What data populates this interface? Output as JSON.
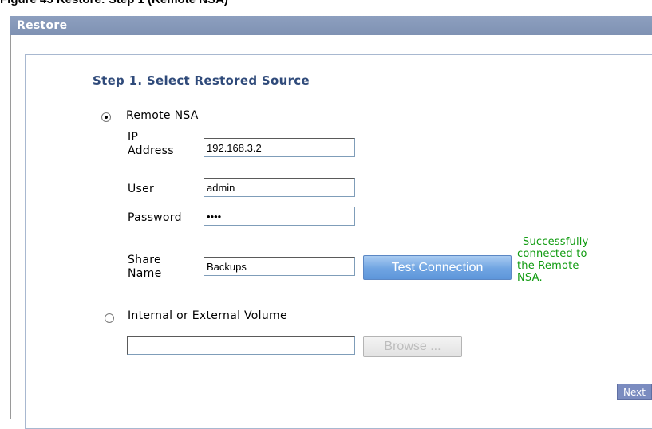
{
  "figure_caption": "Figure 45 Restore: Step 1 (Remote NSA)",
  "header": {
    "title": "Restore"
  },
  "step": {
    "title": "Step 1. Select Restored Source"
  },
  "source_options": [
    {
      "label": "Remote NSA",
      "selected": true
    },
    {
      "label": "Internal or External Volume",
      "selected": false
    }
  ],
  "remote": {
    "ip_label_line1": "IP",
    "ip_label_line2": "Address",
    "ip_value": "192.168.3.2",
    "user_label": "User",
    "user_value": "admin",
    "password_label": "Password",
    "password_value": "****",
    "share_label_line1": "Share",
    "share_label_line2": "Name",
    "share_value": "Backups",
    "test_button": "Test Connection",
    "status_lines": [
      "Successfully",
      "connected to",
      "the Remote",
      "NSA."
    ],
    "status_color": "#109b10"
  },
  "volume": {
    "path_value": "",
    "browse_button": "Browse ..."
  },
  "nav": {
    "next_button": "Next"
  },
  "colors": {
    "header_bg": "#8397b8",
    "step_title": "#2f4a7a",
    "test_button": "#6fa4e2",
    "next_button": "#7b8cc0"
  }
}
